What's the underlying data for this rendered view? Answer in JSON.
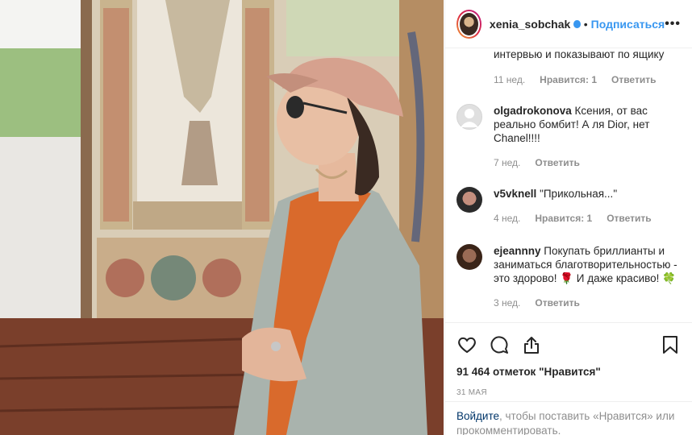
{
  "header": {
    "username": "xenia_sobchak",
    "follow_label": "Подписаться",
    "more_icon": "more-horizontal-icon"
  },
  "comments": [
    {
      "username": "",
      "text": "интервью и показывают по ящику",
      "age": "11 нед.",
      "likes": "Нравится: 1",
      "reply": "Ответить"
    },
    {
      "username": "olgadrokonova",
      "text": "Ксения, от вас реально бомбит! А ля Dior, нет Chanel!!!!",
      "age": "7 нед.",
      "likes": "",
      "reply": "Ответить"
    },
    {
      "username": "v5vknell",
      "text": "\"Прикольная...\"",
      "age": "4 нед.",
      "likes": "Нравится: 1",
      "reply": "Ответить"
    },
    {
      "username": "ejeannny",
      "text": "Покупать бриллианты и заниматься благотворительностью - это здорово! 🌹 И даже красиво! 🍀",
      "age": "3 нед.",
      "likes": "",
      "reply": "Ответить"
    }
  ],
  "actions": {
    "like_icon": "heart-icon",
    "comment_icon": "comment-icon",
    "share_icon": "share-icon",
    "save_icon": "bookmark-icon",
    "likes_text": "91 464 отметок \"Нравится\"",
    "date": "31 МАЯ"
  },
  "login_prompt": {
    "link": "Войдите",
    "text": ", чтобы поставить «Нравится» или прокомментировать."
  },
  "colors": {
    "link_blue": "#3897f0",
    "muted": "#8e8e8e",
    "border": "#efefef"
  }
}
